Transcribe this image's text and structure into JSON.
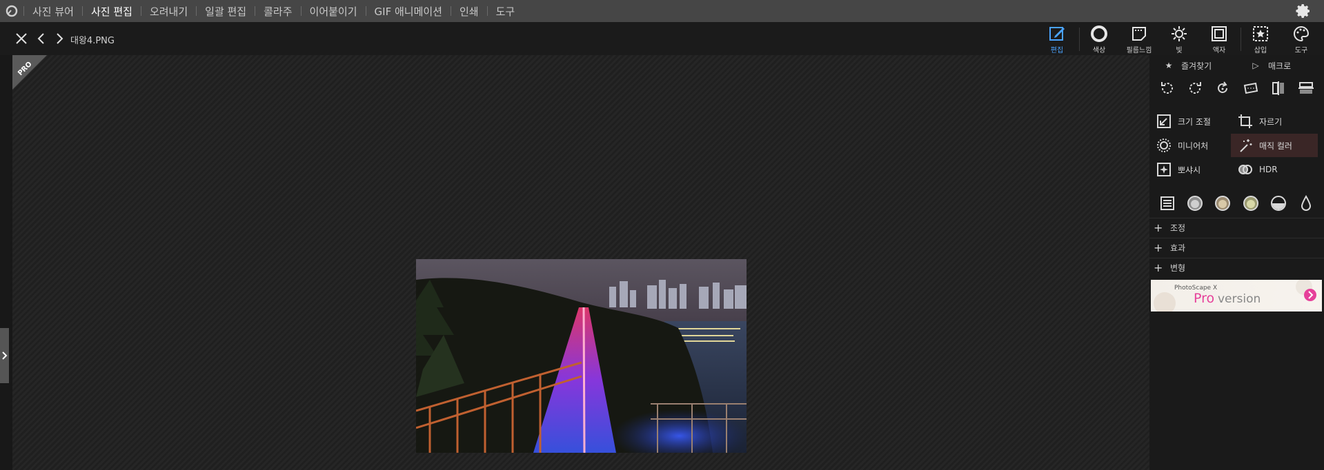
{
  "menu": {
    "items": [
      "사진 뷰어",
      "사진 편집",
      "오려내기",
      "일괄 편집",
      "콜라주",
      "이어붙이기",
      "GIF 애니메이션",
      "인쇄",
      "도구"
    ],
    "active_index": 1
  },
  "toolbar": {
    "filename": "대왕4.PNG",
    "tools": {
      "edit": "편집",
      "color": "색상",
      "film": "필름느낌",
      "light": "빛",
      "frame": "액자",
      "insert": "삽입",
      "tools": "도구"
    }
  },
  "canvas": {
    "pro_badge": "PRO"
  },
  "panel": {
    "favorites": "즐겨찾기",
    "macro": "매크로",
    "features": {
      "resize": "크기 조절",
      "crop": "자르기",
      "miniature": "미니어처",
      "magic_color": "매직 컬러",
      "bokeh": "뽀샤시",
      "hdr": "HDR"
    },
    "sections": [
      "조정",
      "효과",
      "변형"
    ],
    "ad": {
      "top": "PhotoScape X",
      "pro": "Pro",
      "version": "version"
    }
  },
  "colors": {
    "accent": "#4aa3ff",
    "highlight_bg": "#3a2626",
    "ad_pink": "#e6409a"
  }
}
